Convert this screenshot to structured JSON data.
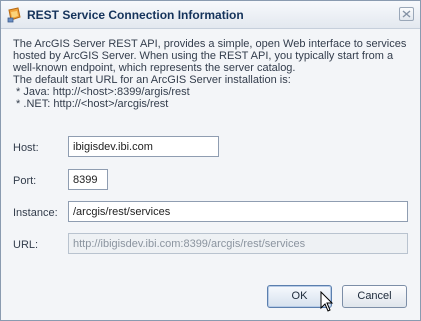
{
  "dialog": {
    "title": "REST Service Connection Information",
    "info_lines": [
      "The ArcGIS Server REST API, provides a simple, open Web interface to services",
      "hosted by ArcGIS Server. When using the REST API, you typically start from a",
      "well-known endpoint, which represents the server catalog.",
      "The default start URL for an ArcGIS Server installation is:",
      " * Java: http://<host>:8399/argis/rest",
      " * .NET: http://<host>/arcgis/rest"
    ]
  },
  "form": {
    "host": {
      "label": "Host:",
      "value": "ibigisdev.ibi.com"
    },
    "port": {
      "label": "Port:",
      "value": "8399"
    },
    "instance": {
      "label": "Instance:",
      "value": "/arcgis/rest/services"
    },
    "url": {
      "label": "URL:",
      "value": "http://ibigisdev.ibi.com:8399/arcgis/rest/services"
    }
  },
  "buttons": {
    "ok": "OK",
    "cancel": "Cancel"
  },
  "icons": {
    "title": "arcgis-service-icon",
    "close": "close-icon",
    "cursor": "mouse-pointer-icon"
  }
}
